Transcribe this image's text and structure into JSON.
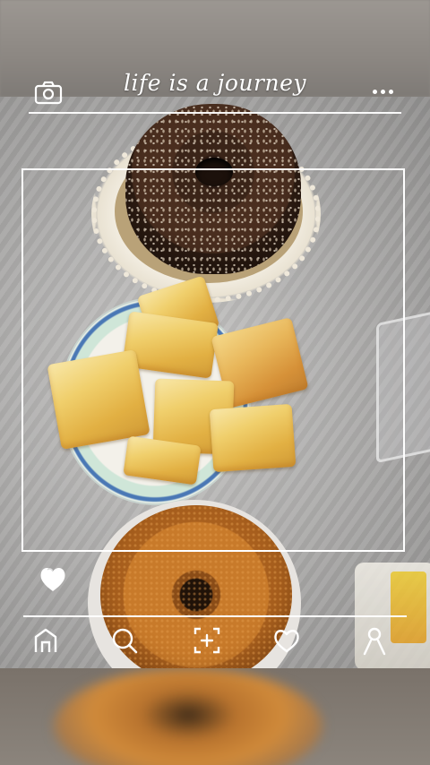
{
  "app": {
    "title": "life is a journey"
  },
  "header": {
    "left_icon": "camera-icon",
    "right_icon": "more-dots-icon"
  },
  "photo": {
    "subjects": [
      "chocolate-coconut-bundt-cake",
      "glazed-puff-pastries-plate",
      "orange-bundt-cake"
    ]
  },
  "overlay": {
    "like_icon": "heart-filled-icon"
  },
  "bottom_nav": {
    "items": [
      {
        "icon": "home-icon"
      },
      {
        "icon": "search-icon"
      },
      {
        "icon": "add-photo-icon"
      },
      {
        "icon": "heart-outline-icon"
      },
      {
        "icon": "profile-icon"
      }
    ]
  },
  "colors": {
    "overlay_line": "#ffffff",
    "icon": "#ffffff"
  }
}
